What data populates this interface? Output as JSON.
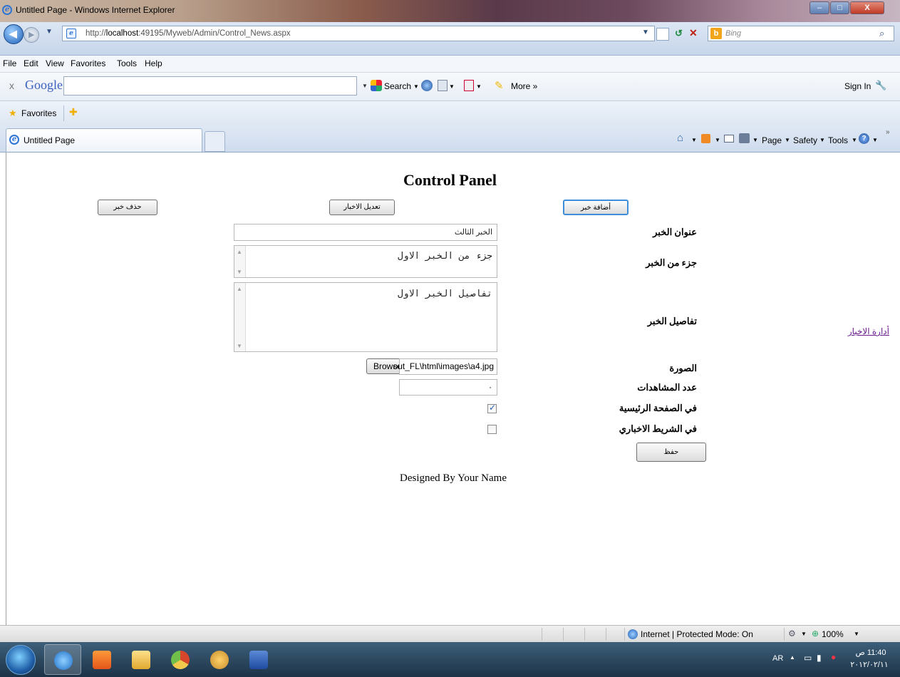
{
  "window": {
    "title": "Untitled Page - Windows Internet Explorer",
    "minimize_glyph": "–",
    "maximize_glyph": "□",
    "close_glyph": "X"
  },
  "address": {
    "url_prefix": "http://",
    "url_host": "localhost",
    "url_rest": ":49195/Myweb/Admin/Control_News.aspx",
    "search_placeholder": "Bing"
  },
  "menu": [
    "File",
    "Edit",
    "View",
    "Favorites",
    "Tools",
    "Help"
  ],
  "google_toolbar": {
    "close": "x",
    "brand": "Google",
    "search_label": "Search",
    "more_label": "More »",
    "signin_label": "Sign In"
  },
  "favorites": {
    "label": "Favorites"
  },
  "tabs": {
    "active_title": "Untitled Page"
  },
  "command_bar": {
    "page": "Page",
    "safety": "Safety",
    "tools": "Tools"
  },
  "page": {
    "heading": "Control Panel",
    "buttons": {
      "add_news": "أضافة خبر",
      "edit_news": "تعديل الاخبار",
      "delete_news": "حذف خبر",
      "save": "حفظ",
      "browse": "Browse..."
    },
    "labels": {
      "title": "عنوان الخبر",
      "excerpt": "جزء من الخبر",
      "details": "تفاصيل الخبر",
      "image": "الصورة",
      "views": "عدد المشاهدات",
      "homepage": "في الصفحة الرئيسية",
      "ticker": "في  الشريط الاخباري"
    },
    "values": {
      "title": "الخبر الثالث",
      "excerpt": "جزء من الخبر الاول",
      "details": "تفاصيل الخبر الاول",
      "image_path": "out_FL\\html\\images\\a4.jpg",
      "views": "٠",
      "homepage_checked": true,
      "ticker_checked": false
    },
    "side_link": "أدارة الاخبار",
    "footer": "Designed By Your Name"
  },
  "status": {
    "zone": "Internet | Protected Mode: On",
    "zoom": "100%"
  },
  "taskbar": {
    "lang": "AR",
    "time": "11:40 ص",
    "date": "٢٠١٢/٠٢/١١"
  }
}
